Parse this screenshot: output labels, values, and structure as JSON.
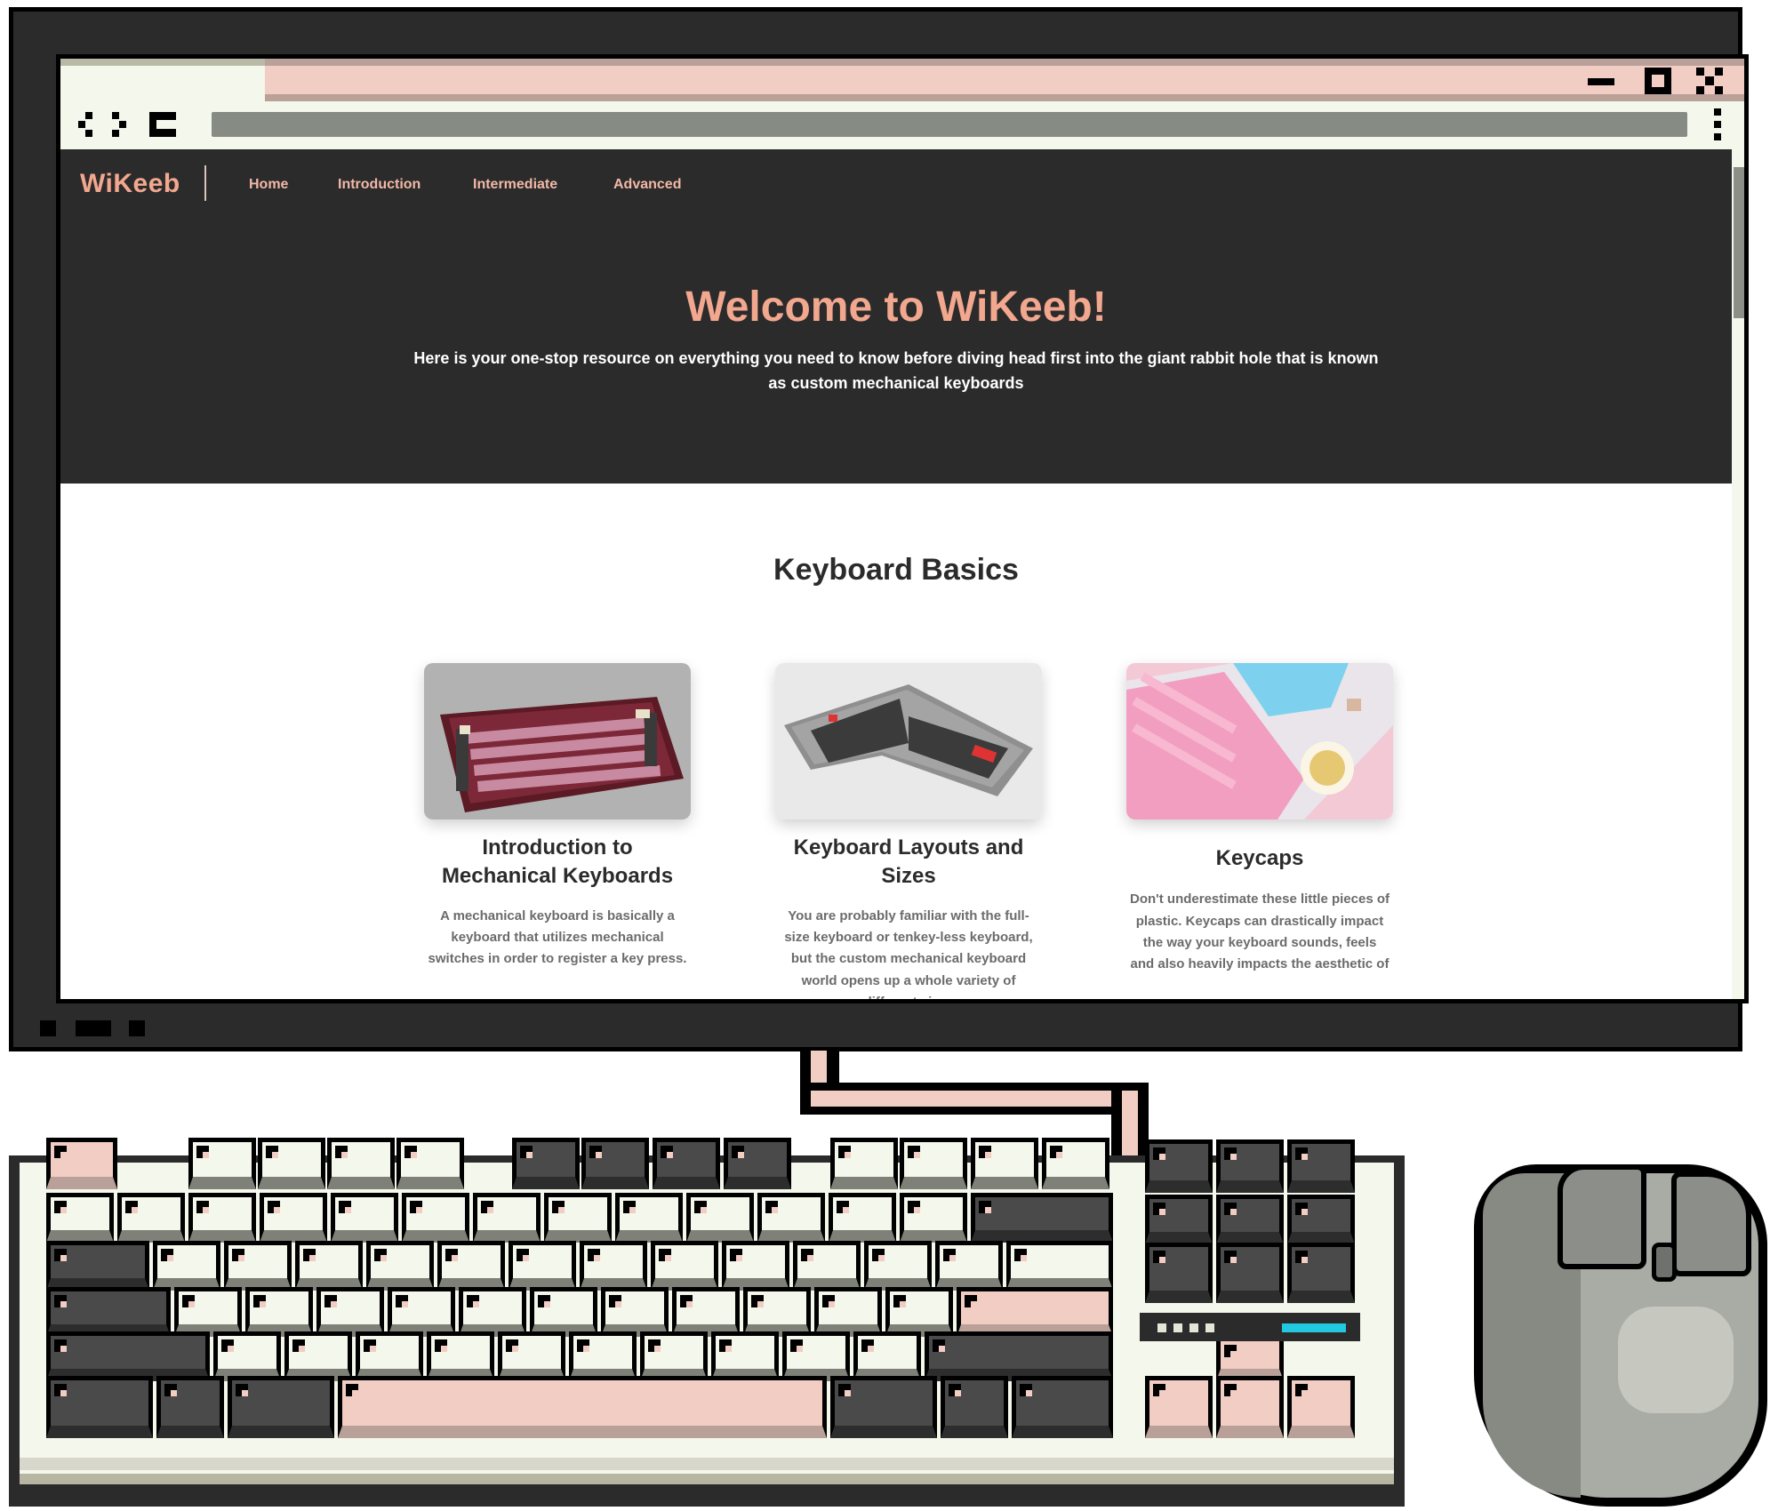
{
  "site": {
    "logo": "WiKeeb",
    "nav": [
      "Home",
      "Introduction",
      "Intermediate",
      "Advanced"
    ]
  },
  "hero": {
    "title": "Welcome to WiKeeb!",
    "subtitle": "Here is your one-stop resource on everything you need to know before diving head first into the giant rabbit hole that is known as custom mechanical keyboards"
  },
  "section": {
    "title": "Keyboard Basics"
  },
  "cards": [
    {
      "title": "Introduction to Mechanical Keyboards",
      "text": "A mechanical keyboard is basically a keyboard that utilizes mechanical switches in order to register a key press."
    },
    {
      "title": "Keyboard Layouts and Sizes",
      "text": "You are probably familiar with the full-size keyboard or tenkey-less keyboard, but the custom mechanical keyboard world opens up a whole variety of different sizes"
    },
    {
      "title": "Keycaps",
      "text": "Don't underestimate these little pieces of plastic. Keycaps can drastically impact the way your keyboard sounds, feels and also heavily impacts the aesthetic of"
    }
  ],
  "colors": {
    "accent": "#f2a78f",
    "dark": "#2b2b2b",
    "cream": "#f4f7ec",
    "pink": "#f2cdc4",
    "gray": "#868b84",
    "led": "#22c7e0"
  },
  "icons": [
    "back-icon",
    "forward-icon",
    "reload-icon",
    "kebab-menu-icon",
    "minimize-icon",
    "maximize-icon",
    "close-icon"
  ]
}
